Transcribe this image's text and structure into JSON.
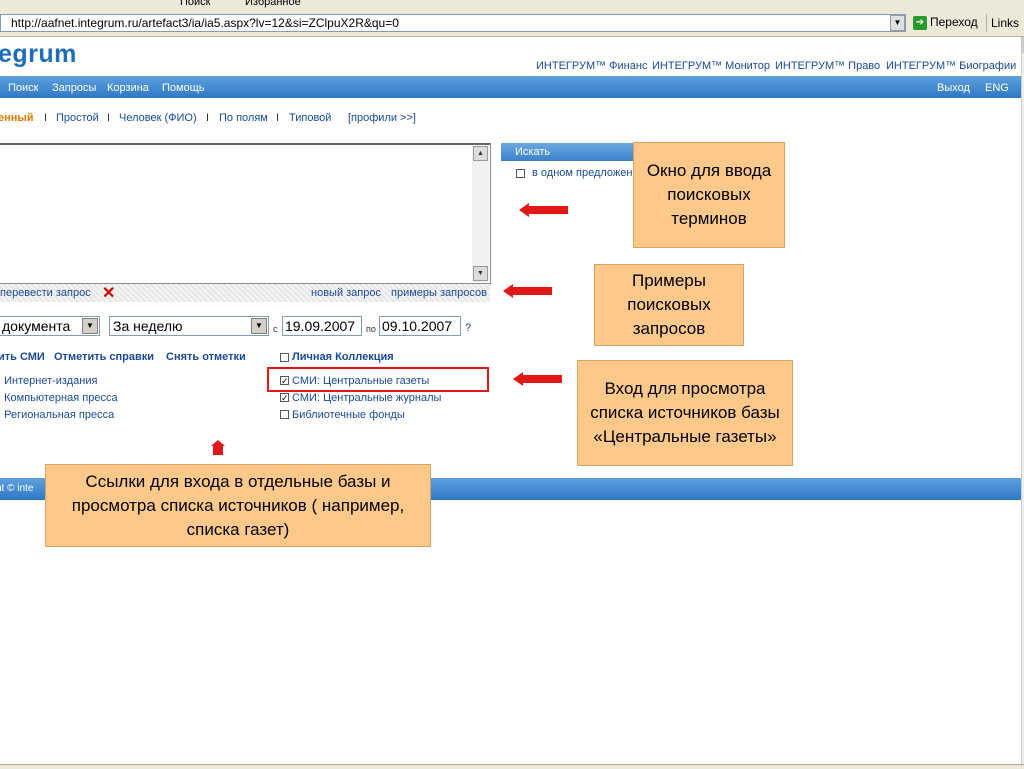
{
  "browser": {
    "toolbar_items": [
      "Поиск",
      "Избранное"
    ],
    "url": "http://aafnet.integrum.ru/artefact3/ia/ia5.aspx?lv=12&si=ZClpuX2R&qu=0",
    "go_label": "Переход",
    "links_label": "Links"
  },
  "header": {
    "logo": "egrum",
    "top_links": [
      "ИНТЕГРУМ™ Финанс",
      "ИНТЕГРУМ™ Монитор",
      "ИНТЕГРУМ™ Право",
      "ИНТЕГРУМ™ Биографии"
    ]
  },
  "nav": {
    "items": [
      "Поиск",
      "Запросы",
      "Корзина",
      "Помощь"
    ],
    "right": [
      "Выход",
      "ENG"
    ]
  },
  "tabs": {
    "active": "енный",
    "items": [
      "Простой",
      "Человек (ФИО)",
      "По полям",
      "Типовой",
      "[профили >>]"
    ],
    "separator": "I"
  },
  "search": {
    "translate_link": "перевести запрос",
    "new_query": "новый запрос",
    "examples": "примеры запросов",
    "search_button": "Искать",
    "in_sentence": "в одном предложен"
  },
  "filters": {
    "doc_select": "документа",
    "period_select": "За неделю",
    "from_label": "с",
    "to_label": "по",
    "date_from": "19.09.2007",
    "date_to": "09.10.2007",
    "help": "?"
  },
  "sources": {
    "action_links": [
      "ить СМИ",
      "Отметить справки",
      "Снять отметки"
    ],
    "personal_collection": "Личная Коллекция",
    "left_items": [
      ": Интернет-издания",
      ": Компьютерная пресса",
      ": Региональная пресса"
    ],
    "right_items": [
      {
        "label": "СМИ: Центральные газеты",
        "checked": true
      },
      {
        "label": "СМИ: Центральные журналы",
        "checked": true
      },
      {
        "label": "Библиотечные фонды",
        "checked": false
      }
    ]
  },
  "footer": {
    "text": "nt © inte"
  },
  "callouts": {
    "input_window": "Окно для ввода поисковых терминов",
    "examples": "Примеры поисковых запросов",
    "central_papers": "Вход для просмотра списка источников базы «Центральные газеты»",
    "db_links": "Ссылки для входа в отдельные базы и просмотра списка источников ( например, списка газет)"
  },
  "colors": {
    "nav_blue": "#3b82cc",
    "link_blue": "#1a4a9a",
    "callout_bg": "#fcc98a",
    "arrow_red": "#e01818"
  }
}
